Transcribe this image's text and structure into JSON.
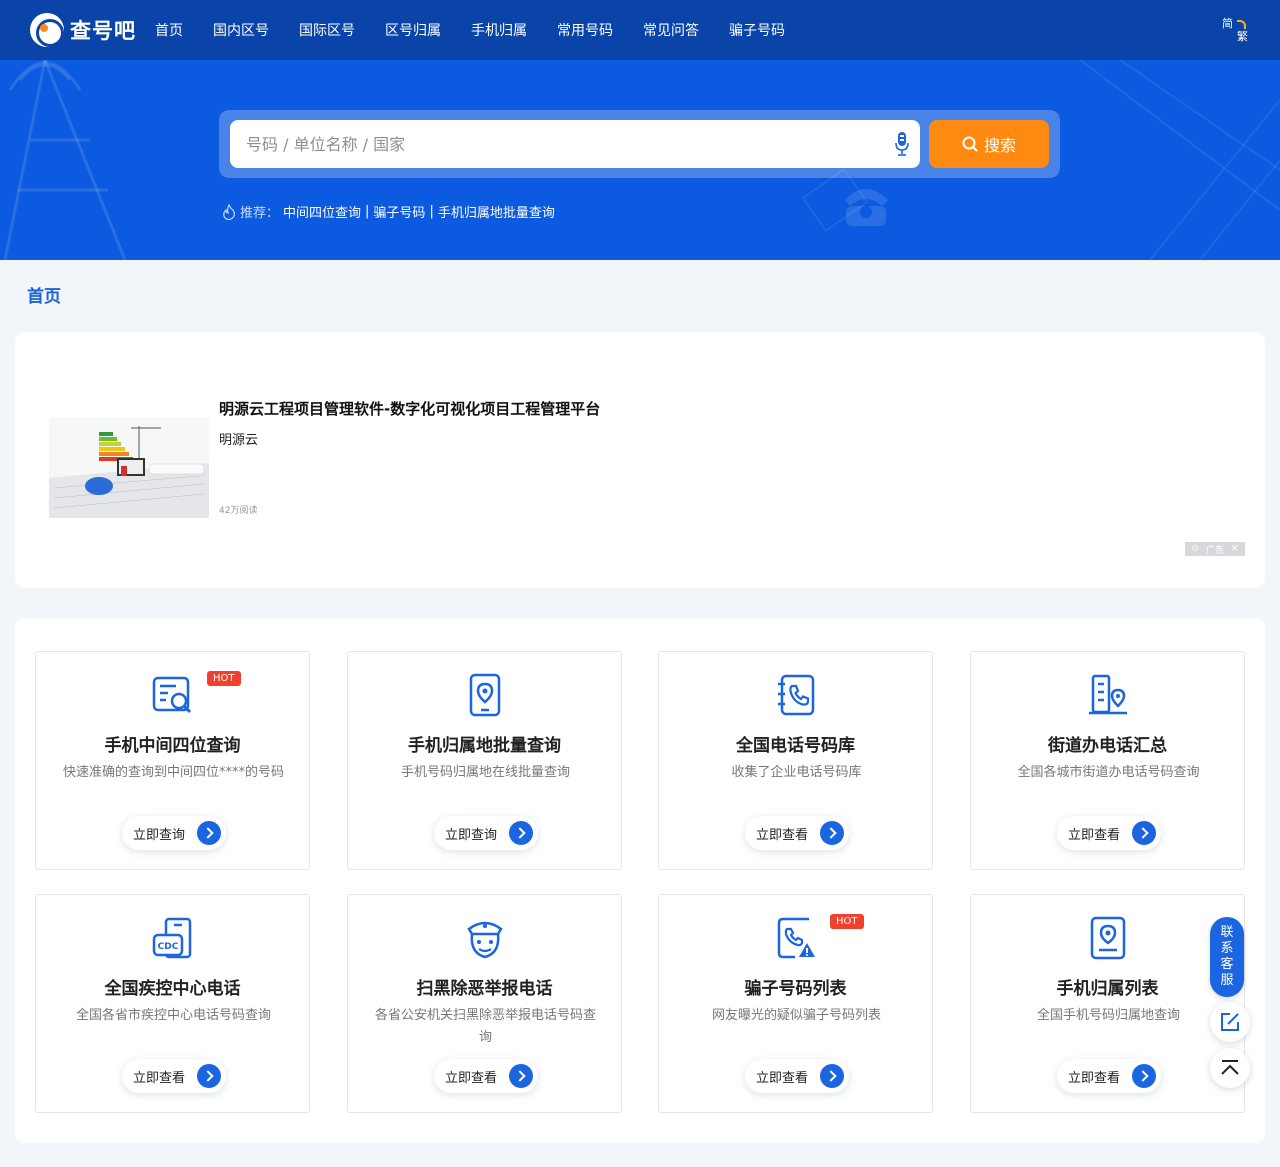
{
  "site": {
    "logo_text": "查号吧",
    "nav": [
      "首页",
      "国内区号",
      "国际区号",
      "区号归属",
      "手机归属",
      "常用号码",
      "常见问答",
      "骗子号码"
    ],
    "lang_switch": {
      "a": "简",
      "b": "繁"
    }
  },
  "search": {
    "placeholder": "号码 / 单位名称 / 国家",
    "button_label": "搜索",
    "recommend_label": "推荐：",
    "recommend_links": [
      "中间四位查询",
      "骗子号码",
      "手机归属地批量查询"
    ],
    "recommend_sep": "|"
  },
  "breadcrumb": "首页",
  "ad": {
    "title": "明源云工程项目管理软件-数字化可视化项目工程管理平台",
    "source": "明源云",
    "reads": "42万阅读",
    "badge": "广告"
  },
  "services": [
    {
      "title": "手机中间四位查询",
      "desc": "快速准确的查询到中间四位****的号码",
      "button": "立即查询",
      "hot": "HOT",
      "icon": "search-document-icon"
    },
    {
      "title": "手机归属地批量查询",
      "desc": "手机号码归属地在线批量查询",
      "button": "立即查询",
      "hot": "",
      "icon": "phone-location-icon"
    },
    {
      "title": "全国电话号码库",
      "desc": "收集了企业电话号码库",
      "button": "立即查看",
      "hot": "",
      "icon": "phone-book-icon"
    },
    {
      "title": "街道办电话汇总",
      "desc": "全国各城市街道办电话号码查询",
      "button": "立即查看",
      "hot": "",
      "icon": "building-location-icon"
    },
    {
      "title": "全国疾控中心电话",
      "desc": "全国各省市疾控中心电话号码查询",
      "button": "立即查看",
      "hot": "",
      "icon": "cdc-icon"
    },
    {
      "title": "扫黑除恶举报电话",
      "desc": "各省公安机关扫黑除恶举报电话号码查询",
      "button": "立即查看",
      "hot": "",
      "icon": "police-icon"
    },
    {
      "title": "骗子号码列表",
      "desc": "网友曝光的疑似骗子号码列表",
      "button": "立即查看",
      "hot": "HOT",
      "icon": "phone-warning-icon"
    },
    {
      "title": "手机归属列表",
      "desc": "全国手机号码归属地查询",
      "button": "立即查看",
      "hot": "",
      "icon": "phone-location-list-icon"
    }
  ],
  "float": {
    "contact_label": [
      "联",
      "系",
      "客",
      "服"
    ]
  },
  "colors": {
    "nav_bg": "#0a44a8",
    "hero_bg": "#0c5ae0",
    "accent": "#1b66e0",
    "search_button": "#ff8a12",
    "hot_badge": "#f0412c"
  }
}
